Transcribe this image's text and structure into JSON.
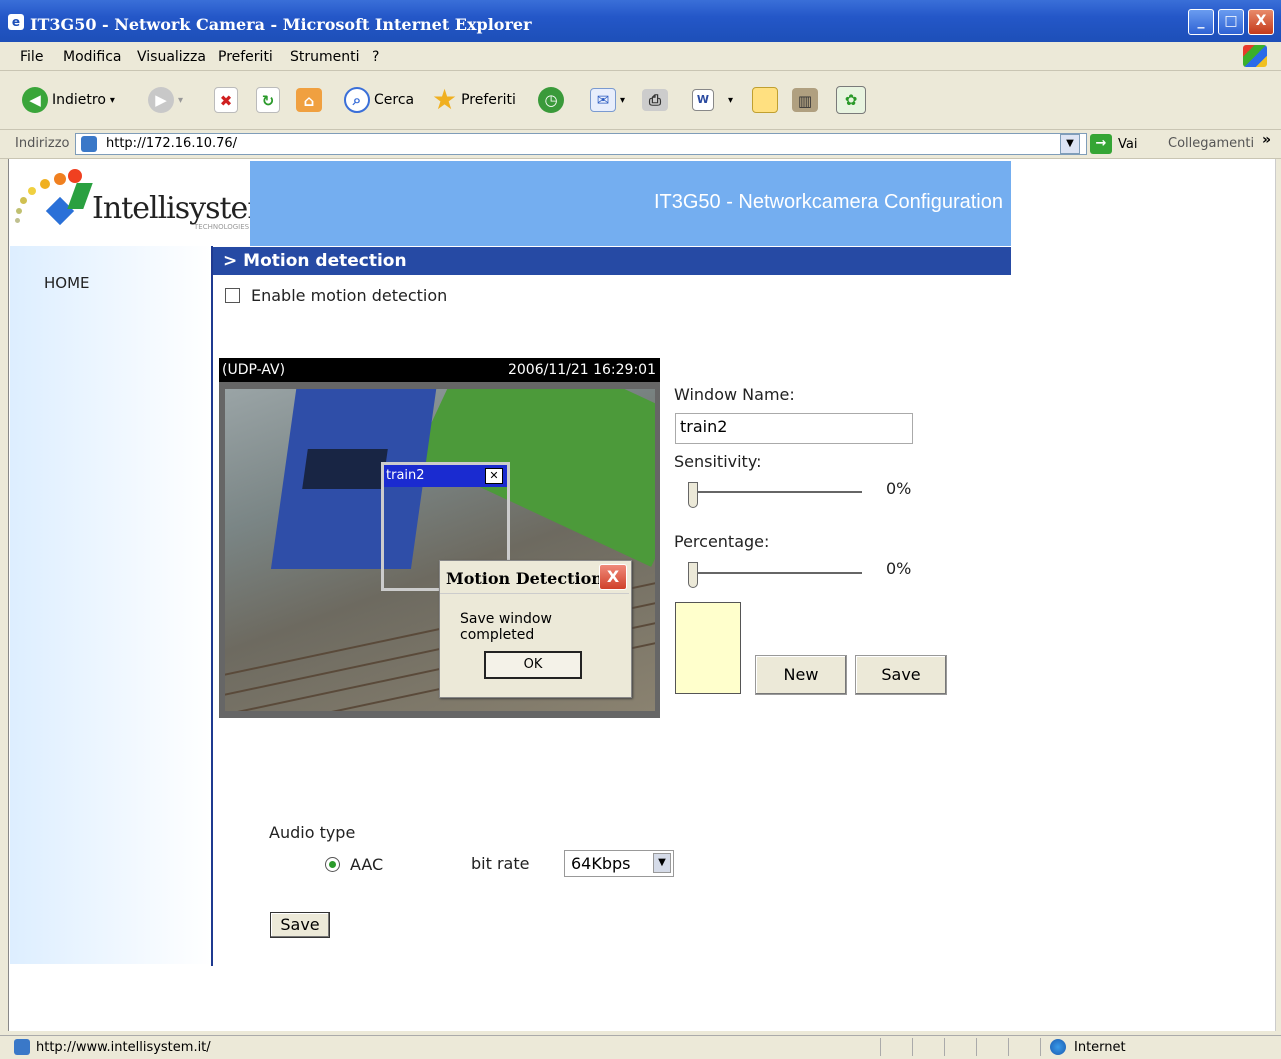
{
  "window": {
    "title": "IT3G50 - Network Camera - Microsoft Internet Explorer",
    "minimize": "_",
    "maximize": "□",
    "close": "X"
  },
  "menu": [
    "File",
    "Modifica",
    "Visualizza",
    "Preferiti",
    "Strumenti",
    "?"
  ],
  "toolbar": {
    "back": "Indietro",
    "search": "Cerca",
    "favorites": "Preferiti"
  },
  "address": {
    "label": "Indirizzo",
    "url": "http://172.16.10.76/",
    "go": "Vai",
    "links": "Collegamenti",
    "more": "»"
  },
  "page": {
    "logo": "Intellisystem",
    "logo_sub": "TECHNOLOGIES",
    "banner_title": "IT3G50 - Networkcamera Configuration",
    "nav_home": "HOME",
    "section_title": "> Motion detection",
    "enable_label": "Enable motion detection",
    "enable_checked": false,
    "video": {
      "mode": "(UDP-AV)",
      "timestamp": "2006/11/21 16:29:01"
    },
    "md_window": {
      "name": "train2",
      "close": "✕"
    },
    "dialog": {
      "title": "Motion Detection",
      "message": "Save window completed",
      "ok": "OK",
      "close": "X"
    },
    "window_name_label": "Window Name:",
    "window_name_value": "train2",
    "sensitivity_label": "Sensitivity:",
    "sensitivity_value": "0%",
    "percentage_label": "Percentage:",
    "percentage_value": "0%",
    "new_button": "New",
    "save_button": "Save",
    "audio_type_label": "Audio type",
    "audio_option": "AAC",
    "bit_rate_label": "bit rate",
    "bit_rate_value": "64Kbps",
    "audio_save": "Save"
  },
  "status": {
    "url": "http://www.intellisystem.it/",
    "zone": "Internet"
  },
  "colors": {
    "banner": "#74aef0",
    "section_bar": "#264aa4",
    "title_bar": "#2457c8"
  }
}
